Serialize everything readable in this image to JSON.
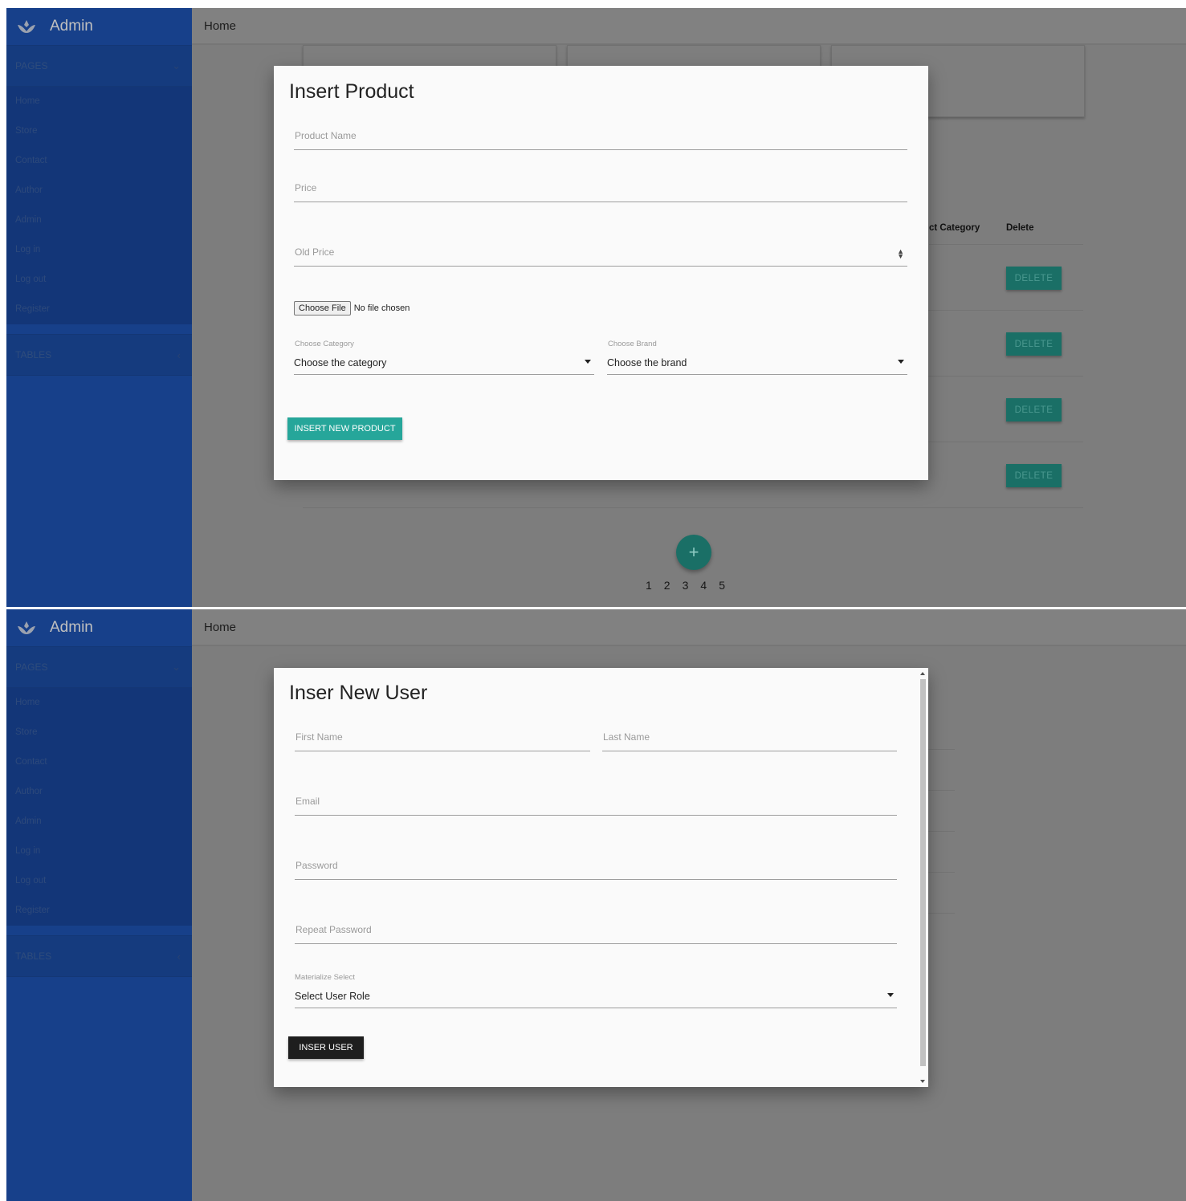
{
  "app": {
    "title": "Admin"
  },
  "sidebar": {
    "pages_label": "PAGES",
    "tables_label": "TABLES",
    "items": [
      {
        "label": "Home"
      },
      {
        "label": "Store"
      },
      {
        "label": "Contact"
      },
      {
        "label": "Author"
      },
      {
        "label": "Admin"
      },
      {
        "label": "Log in"
      },
      {
        "label": "Log out"
      },
      {
        "label": "Register"
      }
    ]
  },
  "topbar": {
    "breadcrumb": "Home"
  },
  "product_table": {
    "headers": [
      "ct Category",
      "Delete"
    ],
    "delete_label": "DELETE",
    "pagination": [
      "1",
      "2",
      "3",
      "4",
      "5"
    ],
    "fab_label": "+"
  },
  "insert_product_modal": {
    "title": "Insert Product",
    "product_name_placeholder": "Product Name",
    "price_placeholder": "Price",
    "old_price_placeholder": "Old Price",
    "file_button": "Choose File",
    "file_status": "No file chosen",
    "category_label": "Choose Category",
    "category_value": "Choose the category",
    "brand_label": "Choose Brand",
    "brand_value": "Choose the brand",
    "submit_label": "INSERT NEW PRODUCT"
  },
  "insert_user_modal": {
    "title": "Inser New User",
    "first_name_placeholder": "First Name",
    "last_name_placeholder": "Last Name",
    "email_placeholder": "Email",
    "password_placeholder": "Password",
    "repeat_password_placeholder": "Repeat Password",
    "role_label": "Materialize Select",
    "role_value": "Select User Role",
    "submit_label": "INSER USER"
  },
  "colors": {
    "sidebar": "#1f56b9",
    "teal": "#26a69a",
    "overlay": "#7d7d7d",
    "dark_button": "#1e1e1e"
  }
}
